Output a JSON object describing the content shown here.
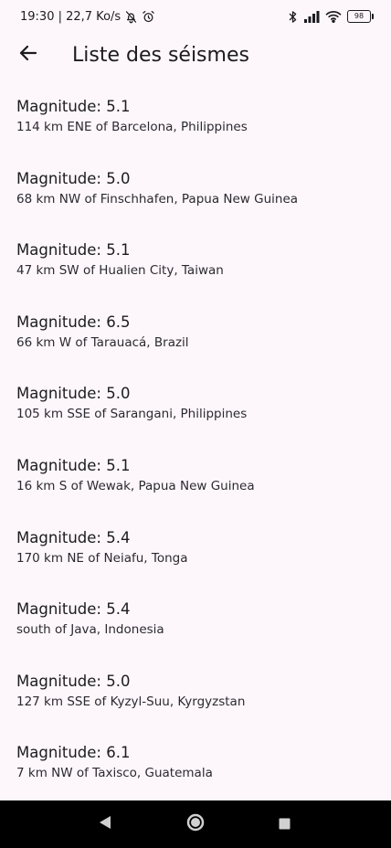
{
  "status_bar": {
    "time_and_speed": "19:30 | 22,7 Ko/s",
    "battery": "98"
  },
  "header": {
    "title": "Liste des séismes"
  },
  "earthquakes": [
    {
      "title": "Magnitude: 5.1",
      "place": "114 km ENE of Barcelona, Philippines"
    },
    {
      "title": "Magnitude: 5.0",
      "place": "68 km NW of Finschhafen, Papua New Guinea"
    },
    {
      "title": "Magnitude: 5.1",
      "place": "47 km SW of Hualien City, Taiwan"
    },
    {
      "title": "Magnitude: 6.5",
      "place": "66 km W of Tarauacá, Brazil"
    },
    {
      "title": "Magnitude: 5.0",
      "place": "105 km SSE of Sarangani, Philippines"
    },
    {
      "title": "Magnitude: 5.1",
      "place": "16 km S of Wewak, Papua New Guinea"
    },
    {
      "title": "Magnitude: 5.4",
      "place": "170 km NE of Neiafu, Tonga"
    },
    {
      "title": "Magnitude: 5.4",
      "place": "south of Java, Indonesia"
    },
    {
      "title": "Magnitude: 5.0",
      "place": "127 km SSE of Kyzyl-Suu, Kyrgyzstan"
    },
    {
      "title": "Magnitude: 6.1",
      "place": "7 km NW of Taxisco, Guatemala"
    }
  ],
  "colors": {
    "background": "#fdf7fc",
    "text": "#1c1b1f",
    "nav_bar": "#000000"
  }
}
